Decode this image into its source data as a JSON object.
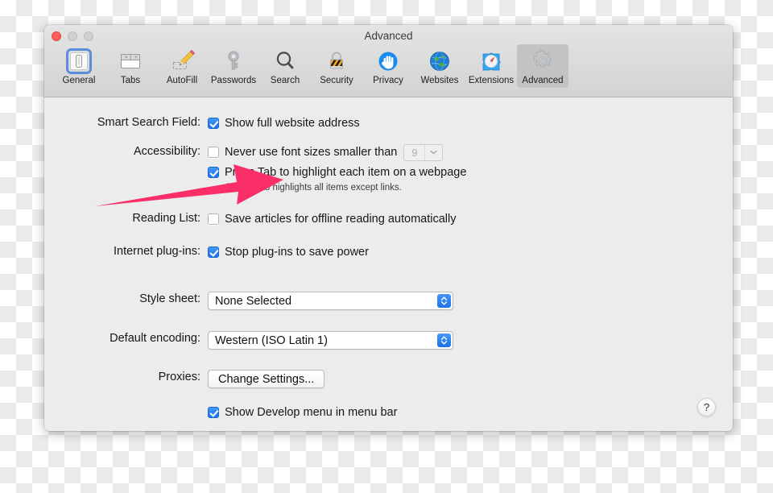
{
  "window": {
    "title": "Advanced",
    "traffic_lights": [
      {
        "name": "close",
        "color": "#ff5f57"
      },
      {
        "name": "minimize",
        "color": "#cfcfcf"
      },
      {
        "name": "zoom",
        "color": "#cfcfcf"
      }
    ]
  },
  "toolbar": {
    "selected": "Advanced",
    "items": [
      {
        "label": "General",
        "icon": "general-icon"
      },
      {
        "label": "Tabs",
        "icon": "tabs-icon"
      },
      {
        "label": "AutoFill",
        "icon": "autofill-pencil-icon"
      },
      {
        "label": "Passwords",
        "icon": "key-icon"
      },
      {
        "label": "Search",
        "icon": "magnifier-icon"
      },
      {
        "label": "Security",
        "icon": "padlock-icon"
      },
      {
        "label": "Privacy",
        "icon": "hand-icon"
      },
      {
        "label": "Websites",
        "icon": "globe-icon"
      },
      {
        "label": "Extensions",
        "icon": "puzzle-compass-icon"
      },
      {
        "label": "Advanced",
        "icon": "gear-icon"
      }
    ]
  },
  "settings": {
    "smart_search": {
      "label": "Smart Search Field:",
      "checkbox_label": "Show full website address",
      "checked": true
    },
    "accessibility": {
      "label": "Accessibility:",
      "font_size_label": "Never use font sizes smaller than",
      "font_size_checked": false,
      "font_size_value": "9",
      "font_size_disabled": true,
      "press_tab_label": "Press Tab to highlight each item on a webpage",
      "press_tab_checked": true,
      "hint": "Option-Tab highlights all items except links."
    },
    "reading_list": {
      "label": "Reading List:",
      "checkbox_label": "Save articles for offline reading automatically",
      "checked": false
    },
    "internet_plugins": {
      "label": "Internet plug-ins:",
      "checkbox_label": "Stop plug-ins to save power",
      "checked": true
    },
    "style_sheet": {
      "label": "Style sheet:",
      "value": "None Selected"
    },
    "default_encoding": {
      "label": "Default encoding:",
      "value": "Western (ISO Latin 1)"
    },
    "proxies": {
      "label": "Proxies:",
      "button_label": "Change Settings..."
    },
    "develop_menu": {
      "checkbox_label": "Show Develop menu in menu bar",
      "checked": true
    }
  },
  "help": {
    "glyph": "?"
  },
  "annotation": {
    "arrow_color": "#fa2e68"
  }
}
